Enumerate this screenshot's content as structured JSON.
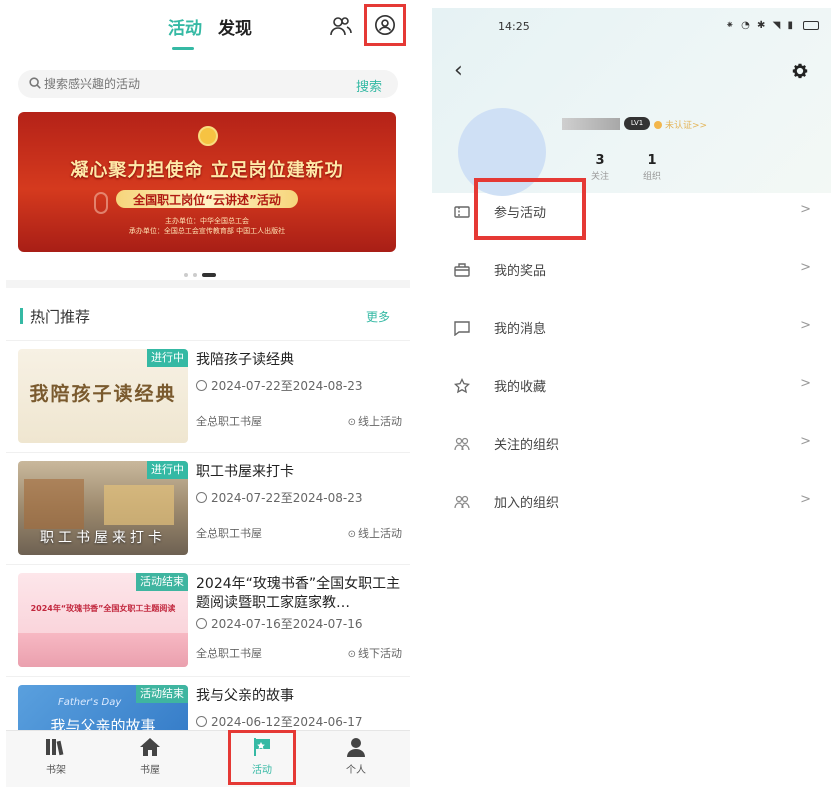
{
  "left": {
    "tabs": {
      "activity": "活动",
      "discover": "发现"
    },
    "search": {
      "placeholder": "搜索感兴趣的活动",
      "button": "搜索"
    },
    "banner": {
      "headline": "凝心聚力担使命 立足岗位建新功",
      "subtitle": "全国职工岗位“云讲述”活动",
      "line1": "主办单位：中华全国总工会",
      "line2": "承办单位：全国总工会宣传教育部 中国工人出版社"
    },
    "section": {
      "title": "热门推荐",
      "more": "更多"
    },
    "cards": [
      {
        "status": "进行中",
        "thumb_text": "我陪孩子读经典",
        "title": "我陪孩子读经典",
        "date": "2024-07-22至2024-08-23",
        "org": "全总职工书屋",
        "mode": "线上活动"
      },
      {
        "status": "进行中",
        "thumb_text": "职工书屋来打卡",
        "title": "职工书屋来打卡",
        "date": "2024-07-22至2024-08-23",
        "org": "全总职工书屋",
        "mode": "线上活动"
      },
      {
        "status": "活动结束",
        "thumb_text": "2024年“玫瑰书香”全国女职工主题阅读",
        "title": "2024年“玫瑰书香”全国女职工主题阅读暨职工家庭家教…",
        "date": "2024-07-16至2024-07-16",
        "org": "全总职工书屋",
        "mode": "线下活动"
      },
      {
        "status": "活动结束",
        "thumb_text": "我与父亲的故事",
        "thumb_text2": "Father's Day",
        "title": "我与父亲的故事",
        "date": "2024-06-12至2024-06-17"
      }
    ],
    "nav": {
      "shelf": "书架",
      "house": "书屋",
      "activity": "活动",
      "me": "个人"
    }
  },
  "right": {
    "status": {
      "time": "14:25"
    },
    "profile": {
      "level": "LV1",
      "auth": "未认证>>",
      "stats": [
        {
          "value": "3",
          "label": "关注"
        },
        {
          "value": "1",
          "label": "组织"
        }
      ]
    },
    "menu": [
      {
        "label": "参与活动",
        "icon": "ticket-icon"
      },
      {
        "label": "我的奖品",
        "icon": "gift-icon"
      },
      {
        "label": "我的消息",
        "icon": "message-icon"
      },
      {
        "label": "我的收藏",
        "icon": "star-icon"
      },
      {
        "label": "关注的组织",
        "icon": "group-icon"
      },
      {
        "label": "加入的组织",
        "icon": "group-icon"
      }
    ],
    "chevron": ">"
  },
  "colors": {
    "accent": "#35b9a4",
    "highlight": "#e53935"
  }
}
